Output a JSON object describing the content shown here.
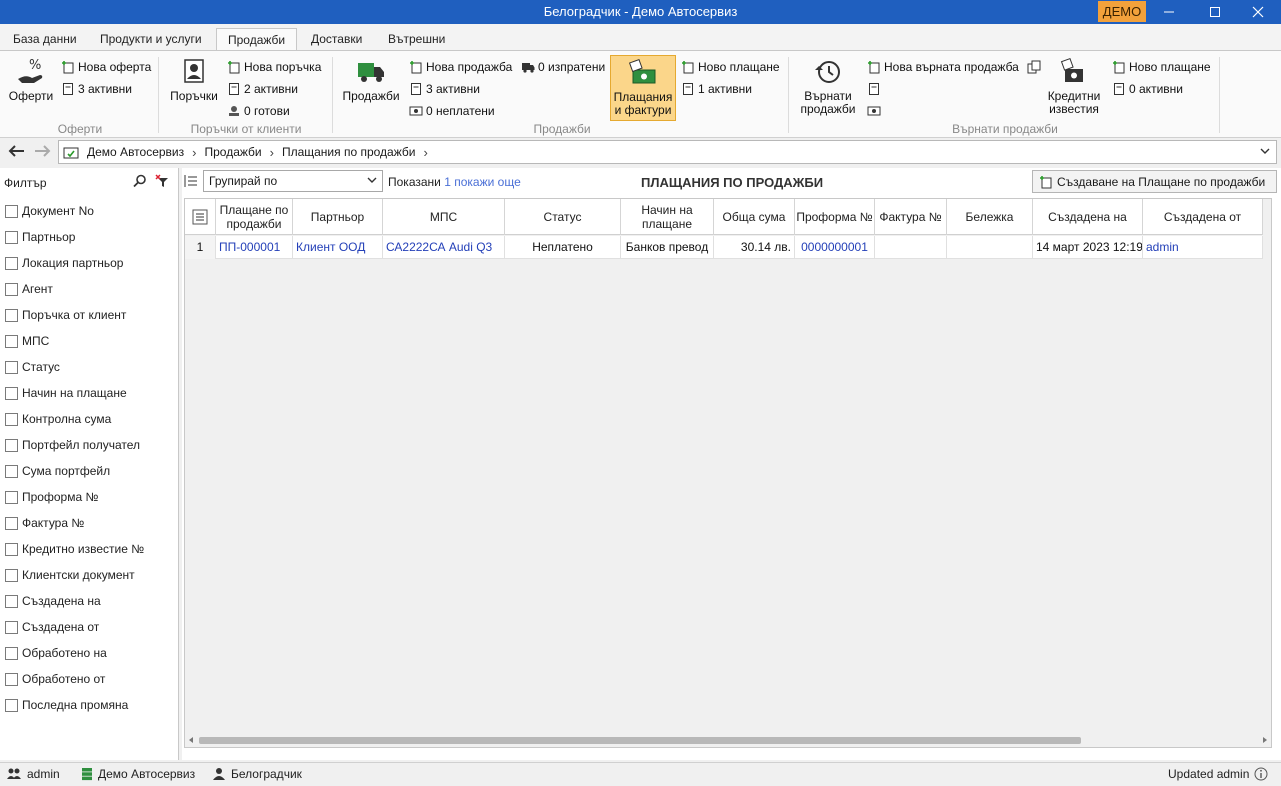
{
  "window": {
    "title": "Белоградчик - Демо Автосервиз",
    "badge": "ДЕМО"
  },
  "tabs": [
    "База данни",
    "Продукти и услуги",
    "Продажби",
    "Доставки",
    "Вътрешни"
  ],
  "active_tab": "Продажби",
  "ribbon": {
    "offers": {
      "big": "Оферти",
      "new": "Нова оферта",
      "active": "3 активни",
      "group": "Оферти"
    },
    "orders": {
      "big": "Поръчки",
      "new": "Нова поръчка",
      "active": "2 активни",
      "ready": "0 готови",
      "group": "Поръчки от клиенти"
    },
    "sales": {
      "big": "Продажби",
      "new": "Нова продажба",
      "active": "3 активни",
      "unpaid": "0 неплатени",
      "sent": "0 изпратени",
      "group": "Продажби"
    },
    "payments": {
      "big": "Плащания\nи фактури",
      "new": "Ново плащане",
      "active": "1 активни"
    },
    "returns": {
      "big": "Върнати\nпродажби",
      "new": "Нова върната продажба",
      "group": "Върнати продажби"
    },
    "credit": {
      "big": "Кредитни\nизвестия",
      "new": "Ново плащане",
      "active": "0 активни"
    }
  },
  "breadcrumb": [
    "Демо Автосервиз",
    "Продажби",
    "Плащания по продажби"
  ],
  "filter": {
    "label": "Филтър",
    "items": [
      "Документ No",
      "Партньор",
      "Локация партньор",
      "Агент",
      "Поръчка от клиент",
      "МПС",
      "Статус",
      "Начин на плащане",
      "Контролна сума",
      "Портфейл получател",
      "Сума портфейл",
      "Проформа №",
      "Фактура №",
      "Кредитно известие №",
      "Клиентски документ",
      "Създадена на",
      "Създадена от",
      "Обработено на",
      "Обработено от",
      "Последна промяна"
    ]
  },
  "main": {
    "group_by": "Групирай по",
    "shown_label": "Показани",
    "shown_count": "1",
    "show_more": "покажи още",
    "page_title": "ПЛАЩАНИЯ ПО ПРОДАЖБИ",
    "create_button": "Създаване на Плащане по продажби"
  },
  "table": {
    "columns": [
      "Плащане по продажби",
      "Партньор",
      "МПС",
      "Статус",
      "Начин на плащане",
      "Обща сума",
      "Проформа №",
      "Фактура №",
      "Бележка",
      "Създадена на",
      "Създадена от"
    ],
    "rows": [
      {
        "rownum": "1",
        "cells": [
          "ПП-000001",
          "Клиент ООД",
          "СА2222СА Audi Q3",
          "Неплатено",
          "Банков превод",
          "30.14 лв.",
          "0000000001",
          "",
          "",
          "14 март 2023 12:19",
          "admin"
        ]
      }
    ]
  },
  "status": {
    "user": "admin",
    "company": "Демо Автосервиз",
    "location": "Белоградчик",
    "updated": "Updated admin"
  }
}
